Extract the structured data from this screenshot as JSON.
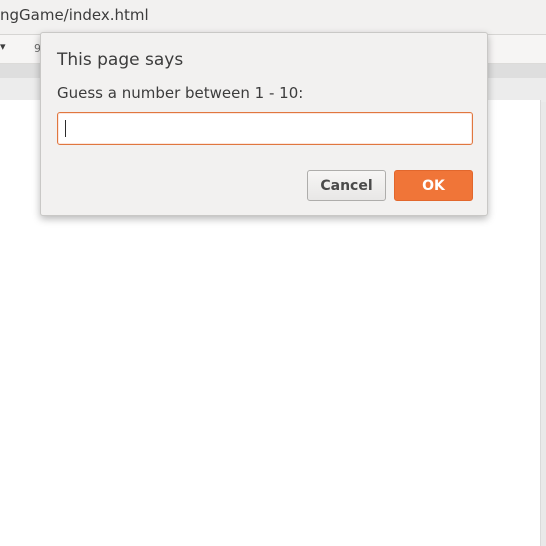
{
  "browser": {
    "location_text": "ngGame/index.html",
    "dropdown_glyph": "▾",
    "zoom_partial": "9"
  },
  "dialog": {
    "title": "This page says",
    "message": "Guess a number between 1 - 10:",
    "input_value": "",
    "cancel_label": "Cancel",
    "ok_label": "OK"
  },
  "colors": {
    "accent": "#f07538",
    "dialog_bg": "#f2f1f0",
    "text": "#3c3c3c"
  }
}
